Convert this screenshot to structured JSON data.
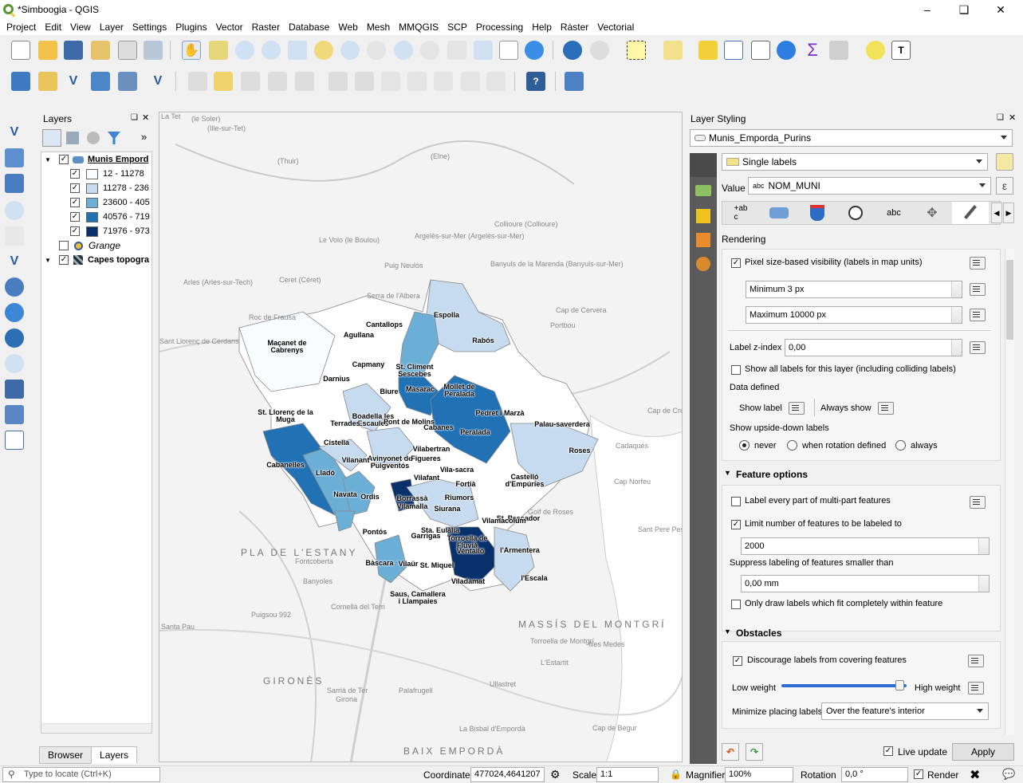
{
  "app": {
    "title": "*Simboogia - QGIS"
  },
  "menu": [
    "Project",
    "Edit",
    "View",
    "Layer",
    "Settings",
    "Plugins",
    "Vector",
    "Raster",
    "Database",
    "Web",
    "Mesh",
    "MMQGIS",
    "SCP",
    "Processing",
    "Help",
    "Ràster",
    "Vectorial"
  ],
  "layers_panel": {
    "title": "Layers",
    "tabs": [
      "Browser",
      "Layers"
    ],
    "layer_name": "Munis Empord",
    "classes": [
      {
        "label": "12 - 11278",
        "color": "#f7fbff"
      },
      {
        "label": "11278 - 236",
        "color": "#c6dbef"
      },
      {
        "label": "23600 - 405",
        "color": "#6baed6"
      },
      {
        "label": "40576 - 719",
        "color": "#2171b5"
      },
      {
        "label": "71976 - 973",
        "color": "#08306b"
      }
    ],
    "grange": "Grange",
    "capes": "Capes topogra"
  },
  "styling": {
    "title": "Layer Styling",
    "layer": "Munis_Emporda_Purins",
    "mode": "Single labels",
    "value_label": "Value",
    "value_field": "NOM_MUNI",
    "section_title": "Rendering",
    "pixel_vis": "Pixel size-based visibility (labels in map units)",
    "min_px": "Minimum 3 px",
    "max_px": "Maximum 10000 px",
    "zindex_label": "Label z-index",
    "zindex": "0,00",
    "show_all": "Show all labels for this layer (including colliding labels)",
    "data_defined": "Data defined",
    "show_label": "Show label",
    "always_show": "Always show",
    "upside_down": "Show upside-down labels",
    "radio_never": "never",
    "radio_rotation": "when rotation defined",
    "radio_always": "always",
    "feature_options": "Feature options",
    "label_every": "Label every part of multi-part features",
    "limit_features": "Limit number of features to be labeled to",
    "limit_value": "2000",
    "suppress": "Suppress labeling of features smaller than",
    "suppress_value": "0,00 mm",
    "only_draw": "Only draw labels which fit completely within feature",
    "obstacles": "Obstacles",
    "discourage": "Discourage labels from covering features",
    "low_weight": "Low weight",
    "high_weight": "High weight",
    "weight_level": 0.95,
    "minimize": "Minimize placing labels",
    "minimize_value": "Over the feature's interior",
    "live_update": "Live update",
    "apply": "Apply"
  },
  "statusbar": {
    "locate_placeholder": "Type to locate (Ctrl+K)",
    "coordinate_label": "Coordinate",
    "coordinate": "477024,4641207",
    "scale_label": "Scale",
    "scale": "1:1",
    "magnifier_label": "Magnifier",
    "magnifier": "100%",
    "rotation_label": "Rotation",
    "rotation": "0,0 °",
    "render": "Render"
  },
  "map": {
    "labels": [
      "Maçanet de Cabrenys",
      "Agullana",
      "Cantallops",
      "Espolla",
      "Rabós",
      "Capmany",
      "St. Climent Sescebes",
      "Darnius",
      "Masarac",
      "Mollet de Peralada",
      "St. Llorenç de la Muga",
      "Biure",
      "Boadella les Escaules",
      "Terrades",
      "Pont de Molins",
      "Cabanes",
      "Pedret i Marzà",
      "Peralada",
      "Palau-saverdera",
      "Cistella",
      "Vilabertran",
      "Avinyonet de Puigventós",
      "Vilanant",
      "Cabanelles",
      "Lladó",
      "Figueres",
      "Vila-sacra",
      "Vilafant",
      "Castelló d'Empúries",
      "Roses",
      "Navata",
      "Ordis",
      "Borrassà",
      "Vilamalla",
      "Fortià",
      "Riumors",
      "Siurana",
      "St. Pescador",
      "Vilamacolum",
      "Pontós",
      "Garrigas",
      "Sta. Eulàlia",
      "Torroella de Fluvià",
      "Ventalló",
      "l'Armentera",
      "Bàscara",
      "Vilaür",
      "St. Miquel",
      "Saus, Camallera i Llampaies",
      "Viladamat",
      "l'Escala"
    ],
    "bg": [
      "La Tet",
      "(le Soler)",
      "(Ille-sur-Tet)",
      "(Thuir)",
      "(Elne)",
      "Collioure (Collioure)",
      "Le Volo (le Boulou)",
      "Argelès-sur-Mer (Argelès-sur-Mer)",
      "Puig Neulós",
      "Banyuls de la Marenda (Banyuls-sur-Mer)",
      "Ceret (Céret)",
      "Arles (Arles-sur-Tech)",
      "Roc de Frausa",
      "Cap de Cervera",
      "Portbou",
      "Cap de Creus",
      "Cadaqués",
      "Cap Norfeu",
      "Golf de Roses",
      "Sant Pere Pescador",
      "PLA DE L'ESTANY",
      "Banyoles",
      "GIRONÈS",
      "Girona",
      "Cap de Begur",
      "Illes Medes",
      "La Bisbal d'Empordà",
      "BAIX EMPORDÀ",
      "Ullastret",
      "Torroella de Montgrí",
      "L'Estartit",
      "MASSÍS DEL MONTGRÍ",
      "Puigsou 992",
      "Fontcoberta",
      "Cornellà del Terri",
      "Sant Llorenç de Cerdans",
      "Serra de l'Albera",
      "Palafrugell",
      "Santa Pau",
      "Sarrià de Ter"
    ]
  }
}
